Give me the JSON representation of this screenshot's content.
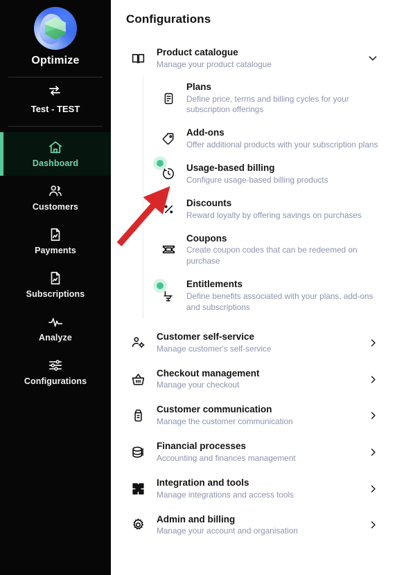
{
  "sidebar": {
    "brand": {
      "name": "Optimize",
      "logo_icon": "optimize-logo"
    },
    "environment": {
      "name": "Test - TEST",
      "icon": "swap-arrows-icon"
    },
    "items": [
      {
        "label": "Dashboard",
        "icon": "home-icon",
        "active": true
      },
      {
        "label": "Customers",
        "icon": "users-icon",
        "active": false
      },
      {
        "label": "Payments",
        "icon": "document-chart-icon",
        "active": false
      },
      {
        "label": "Subscriptions",
        "icon": "document-chart-icon",
        "active": false
      },
      {
        "label": "Analyze",
        "icon": "pulse-icon",
        "active": false
      },
      {
        "label": "Configurations",
        "icon": "sliders-icon",
        "active": false
      }
    ]
  },
  "main": {
    "title": "Configurations",
    "product_catalogue": {
      "title": "Product catalogue",
      "desc": "Manage your product catalogue",
      "icon": "book-open-icon",
      "chevron": "chevron-down-icon",
      "expanded": true,
      "children": [
        {
          "title": "Plans",
          "desc": "Define price, terms and billing cycles for your subscription offerings",
          "icon": "list-document-icon",
          "dot": false
        },
        {
          "title": "Add-ons",
          "desc": "Offer additional products with your subscription plans",
          "icon": "tag-icon",
          "dot": false
        },
        {
          "title": "Usage-based billing",
          "desc": "Configure usage-based billing products",
          "icon": "clock-icon",
          "dot": true
        },
        {
          "title": "Discounts",
          "desc": "Reward loyalty by offering savings on purchases",
          "icon": "percent-icon",
          "dot": false
        },
        {
          "title": "Coupons",
          "desc": "Create coupon codes that can be redeemed on purchase",
          "icon": "ticket-icon",
          "dot": false
        },
        {
          "title": "Entitlements",
          "desc": "Define benefits associated with your plans, add-ons and subscriptions",
          "icon": "seat-icon",
          "dot": true
        }
      ]
    },
    "sections": [
      {
        "title": "Customer self-service",
        "desc": "Manage customer's self-service",
        "icon": "user-gear-icon",
        "chevron": "chevron-right-icon"
      },
      {
        "title": "Checkout management",
        "desc": "Manage your checkout",
        "icon": "basket-icon",
        "chevron": "chevron-right-icon"
      },
      {
        "title": "Customer communication",
        "desc": "Manage the customer communication",
        "icon": "megaphone-icon",
        "chevron": "chevron-right-icon"
      },
      {
        "title": "Financial processes",
        "desc": "Accounting and finances management",
        "icon": "database-icon",
        "chevron": "chevron-right-icon"
      },
      {
        "title": "Integration and tools",
        "desc": "Manage integrations and access tools",
        "icon": "puzzle-icon",
        "chevron": "chevron-right-icon"
      },
      {
        "title": "Admin and billing",
        "desc": "Manage your account and organisation",
        "icon": "gear-icon",
        "chevron": "chevron-right-icon"
      }
    ]
  },
  "annotation": {
    "type": "arrow",
    "color": "#d8282a",
    "points_to": "Usage-based billing"
  },
  "colors": {
    "sidebar_bg": "#070707",
    "active_accent": "#57c99a",
    "active_text": "#6fd5a8",
    "title_text": "#141414",
    "desc_text": "#8d93b0",
    "dot_halo": "#d6f3e4",
    "dot_core": "#3fc792",
    "annotation_red": "#d8282a"
  }
}
